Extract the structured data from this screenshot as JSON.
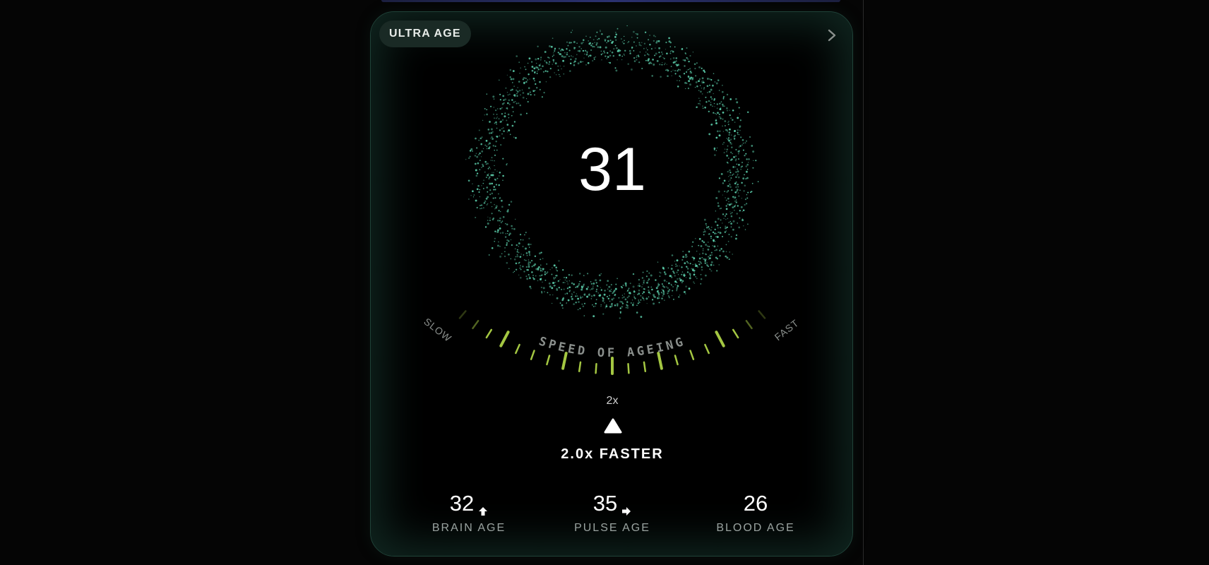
{
  "card": {
    "badge": "ULTRA AGE",
    "age": "31",
    "gauge": {
      "title": "SPEED OF AGEING",
      "left_label": "SLOW",
      "right_label": "FAST",
      "value_label": "2x",
      "level": 0.5
    },
    "summary": "2.0x FASTER",
    "metrics": [
      {
        "value": "32",
        "label": "BRAIN AGE",
        "trend": "up-arrow-icon"
      },
      {
        "value": "35",
        "label": "PULSE AGE",
        "trend": "right-arrow-icon"
      },
      {
        "value": "26",
        "label": "BLOOD AGE",
        "trend": ""
      }
    ]
  },
  "colors": {
    "particles": "#5ed4b0",
    "ticks": "#b6dd4a",
    "card_border": "#1f4238"
  }
}
